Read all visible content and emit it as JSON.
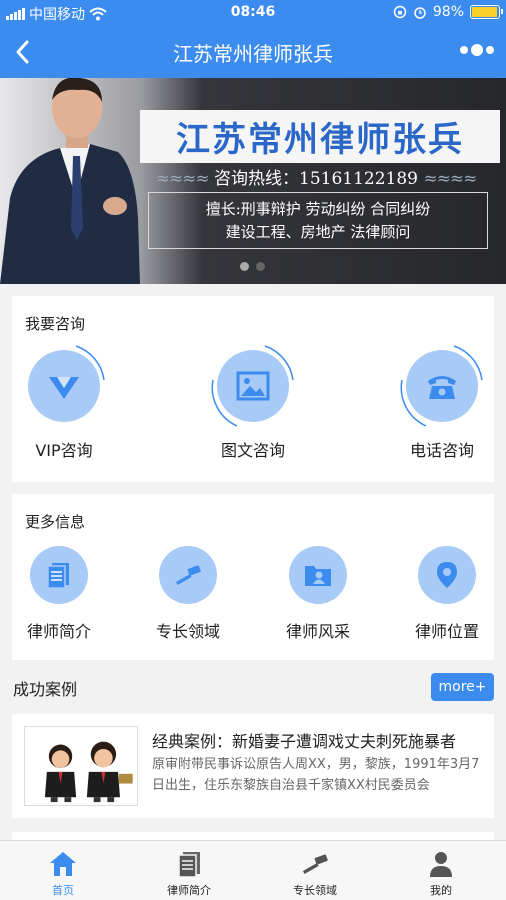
{
  "status_bar": {
    "carrier": "中国移动",
    "time": "08:46",
    "battery": "98%"
  },
  "nav": {
    "title": "江苏常州律师张兵"
  },
  "banner": {
    "title": "江苏常州律师张兵",
    "hotline": "咨询热线：15161122189",
    "specialty_line1": "擅长:刑事辩护  劳动纠纷  合同纠纷",
    "specialty_line2": "建设工程、房地产  法律顾问"
  },
  "consult": {
    "title": "我要咨询",
    "items": [
      {
        "label": "VIP咨询",
        "icon": "vip-icon"
      },
      {
        "label": "图文咨询",
        "icon": "image-icon"
      },
      {
        "label": "电话咨询",
        "icon": "phone-icon"
      }
    ]
  },
  "more_info": {
    "title": "更多信息",
    "items": [
      {
        "label": "律师简介",
        "icon": "document-icon"
      },
      {
        "label": "专长领域",
        "icon": "gavel-icon"
      },
      {
        "label": "律师风采",
        "icon": "folder-user-icon"
      },
      {
        "label": "律师位置",
        "icon": "location-pin-icon"
      }
    ]
  },
  "cases": {
    "title": "成功案例",
    "more_label": "more+",
    "items": [
      {
        "title": "经典案例：新婚妻子遭调戏丈夫刺死施暴者",
        "desc": "原审附带民事诉讼原告人周XX，男，黎族，1991年3月7日出生，住乐东黎族自治县千家镇XX村民委员会"
      }
    ]
  },
  "tab_bar": {
    "tabs": [
      {
        "label": "首页",
        "icon": "home-icon"
      },
      {
        "label": "律师简介",
        "icon": "document-icon"
      },
      {
        "label": "专长领域",
        "icon": "gavel-icon"
      },
      {
        "label": "我的",
        "icon": "user-icon"
      }
    ]
  },
  "colors": {
    "primary": "#3c8cf0",
    "icon_circle": "#a8caf6",
    "battery": "#f8d22a"
  }
}
